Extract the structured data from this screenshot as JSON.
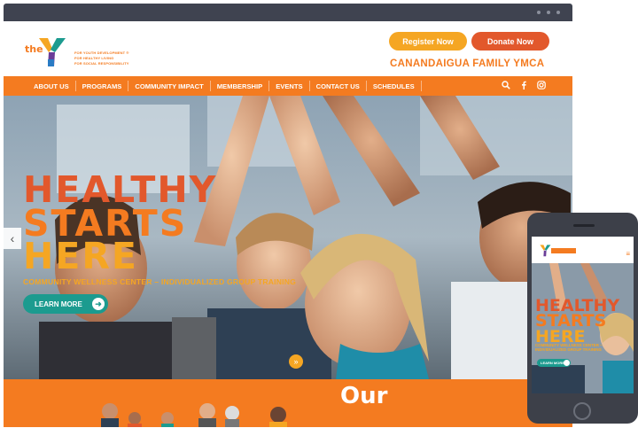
{
  "browser": {
    "dots": 3
  },
  "logo": {
    "brand_word": "the",
    "tagline_lines": [
      "FOR YOUTH DEVELOPMENT ®",
      "FOR HEALTHY LIVING",
      "FOR SOCIAL RESPONSIBILITY"
    ]
  },
  "header": {
    "register_label": "Register Now",
    "donate_label": "Donate Now",
    "site_name": "CANANDAIGUA FAMILY YMCA"
  },
  "nav": {
    "items": [
      "ABOUT US",
      "PROGRAMS",
      "COMMUNITY IMPACT",
      "MEMBERSHIP",
      "EVENTS",
      "CONTACT US",
      "SCHEDULES"
    ],
    "icons": [
      "search-icon",
      "facebook-icon",
      "instagram-icon"
    ]
  },
  "hero": {
    "line1": "HEALTHY",
    "line2": "STARTS",
    "line3": "HERE",
    "subtitle": "COMMUNITY WELLNESS CENTER – INDIVIDUALIZED GROUP TRAINING",
    "cta_label": "LEARN MORE"
  },
  "section": {
    "heading": "Our"
  },
  "mobile": {
    "line1": "HEALTHY",
    "line2": "STARTS",
    "line3": "HERE",
    "subtitle": "COMMUNITY WELLNESS CENTER – INDIVIDUALIZED GROUP TRAINING",
    "cta_label": "LEARN MORE"
  },
  "colors": {
    "orange": "#f47b20",
    "dark_orange": "#e2582c",
    "gold": "#f5a623",
    "teal": "#1c9b8f",
    "chrome": "#3f4350"
  }
}
